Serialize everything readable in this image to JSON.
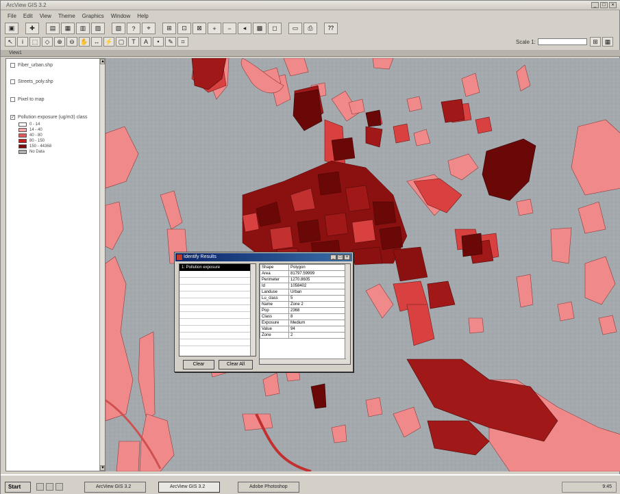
{
  "window": {
    "title": "ArcView GIS 3.2"
  },
  "menu": [
    "File",
    "Edit",
    "View",
    "Theme",
    "Graphics",
    "Window",
    "Help"
  ],
  "toolbar": {
    "scale_label": "Scale 1:",
    "scale_value": ""
  },
  "status_strip": "View1",
  "toc": {
    "items": [
      {
        "label": "Fiber_urban.shp",
        "checked": false
      },
      {
        "label": "Streets_poly.shp",
        "checked": false
      },
      {
        "label": "Pixel to map",
        "checked": false
      },
      {
        "label": "Pollution exposure (ug/m3) class",
        "checked": true
      }
    ],
    "legend": [
      {
        "label": "0 - 14",
        "color": "#ffffff"
      },
      {
        "label": "14 - 40",
        "color": "#f4a6a6"
      },
      {
        "label": "40 - 80",
        "color": "#e05a5a"
      },
      {
        "label": "80 - 150",
        "color": "#c21e1e"
      },
      {
        "label": "150 - 44368",
        "color": "#7d0c0c"
      },
      {
        "label": "No Data",
        "color": "#b0b0b0"
      }
    ]
  },
  "identify": {
    "title": "Identify Results",
    "list_selected": "1: Pollution exposure",
    "rows": [
      [
        "Shape",
        "Polygon"
      ],
      [
        "Area",
        "81797.59999"
      ],
      [
        "Perimeter",
        "1270.8605"
      ],
      [
        "Id",
        "1058402"
      ],
      [
        "Landuse",
        "Urban"
      ],
      [
        "Lu_class",
        "5"
      ],
      [
        "Name",
        "Zone 2"
      ],
      [
        "Pop",
        "2368"
      ],
      [
        "Class",
        "8"
      ],
      [
        "Exposure",
        "Medium"
      ],
      [
        "Value",
        "94"
      ],
      [
        "Zone",
        "2"
      ]
    ],
    "btn_clear": "Clear",
    "btn_clear_all": "Clear All"
  },
  "taskbar": {
    "start": "Start",
    "tasks": [
      {
        "label": "ArcView GIS 3.2",
        "active": false
      },
      {
        "label": "ArcView GIS 3.2",
        "active": true
      },
      {
        "label": "Adobe Photoshop",
        "active": false
      }
    ],
    "clock": "9:45"
  }
}
